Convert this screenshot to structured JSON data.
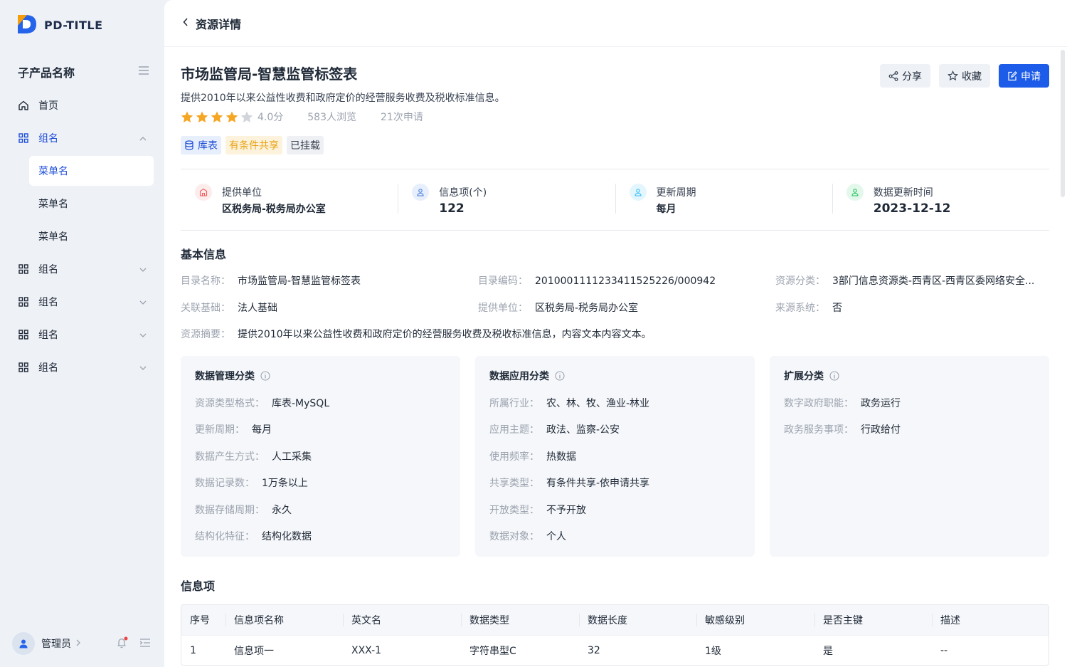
{
  "app": {
    "title": "PD-TITLE"
  },
  "sidebar": {
    "subproduct_title": "子产品名称",
    "items": [
      {
        "label": "首页",
        "icon": "home-icon"
      },
      {
        "label": "组名",
        "icon": "grid-icon",
        "expanded": true,
        "children": [
          {
            "label": "菜单名",
            "active": true
          },
          {
            "label": "菜单名"
          },
          {
            "label": "菜单名"
          }
        ]
      },
      {
        "label": "组名",
        "icon": "grid-icon"
      },
      {
        "label": "组名",
        "icon": "grid-icon"
      },
      {
        "label": "组名",
        "icon": "grid-icon"
      },
      {
        "label": "组名",
        "icon": "grid-icon"
      }
    ],
    "user": {
      "name": "管理员"
    }
  },
  "header": {
    "title": "资源详情"
  },
  "resource": {
    "title": "市场监管局-智慧监管标签表",
    "description": "提供2010年以来公益性收费和政府定价的经营服务收费及税收标准信息。",
    "rating": {
      "stars": 4,
      "max": 5,
      "score": "4.0分"
    },
    "views": "583人浏览",
    "applications": "21次申请",
    "tags": [
      "库表",
      "有条件共享",
      "已挂载"
    ]
  },
  "actions": {
    "share": "分享",
    "favorite": "收藏",
    "apply": "申请"
  },
  "stats": [
    {
      "label": "提供单位",
      "value": "区税务局-税务局办公室",
      "color": "#f25c5c",
      "icon": "building-icon"
    },
    {
      "label": "信息项(个)",
      "value": "122",
      "color": "#4a7fd8",
      "icon": "user-icon"
    },
    {
      "label": "更新周期",
      "value": "每月",
      "color": "#38bdf8",
      "icon": "user-icon"
    },
    {
      "label": "数据更新时间",
      "value": "2023-12-12",
      "color": "#22c55e",
      "icon": "user-icon"
    }
  ],
  "basic_info": {
    "title": "基本信息",
    "fields": [
      {
        "key": "目录名称：",
        "value": "市场监管局-智慧监管标签表"
      },
      {
        "key": "目录编码：",
        "value": "20100011112334115 25226/000942"
      },
      {
        "key": "资源分类：",
        "value": "3部门信息资源类-西青区-西青区委网络安全..."
      },
      {
        "key": "关联基础：",
        "value": "法人基础"
      },
      {
        "key": "提供单位：",
        "value": "区税务局-税务局办公室"
      },
      {
        "key": "来源系统：",
        "value": "否"
      },
      {
        "key": "资源摘要：",
        "value": "提供2010年以来公益性收费和政府定价的经营服务收费及税收标准信息，内容文本内容文本。"
      }
    ]
  },
  "cards": [
    {
      "title": "数据管理分类",
      "rows": [
        {
          "key": "资源类型格式：",
          "value": "库表-MySQL"
        },
        {
          "key": "更新周期：",
          "value": "每月"
        },
        {
          "key": "数据产生方式：",
          "value": "人工采集"
        },
        {
          "key": "数据记录数：",
          "value": "1万条以上"
        },
        {
          "key": "数据存储周期：",
          "value": "永久"
        },
        {
          "key": "结构化特征：",
          "value": "结构化数据"
        }
      ]
    },
    {
      "title": "数据应用分类",
      "rows": [
        {
          "key": "所属行业：",
          "value": "农、林、牧、渔业-林业"
        },
        {
          "key": "应用主题：",
          "value": "政法、监察-公安"
        },
        {
          "key": "使用频率：",
          "value": "热数据"
        },
        {
          "key": "共享类型：",
          "value": "有条件共享-依申请共享"
        },
        {
          "key": "开放类型：",
          "value": "不予开放"
        },
        {
          "key": "数据对象：",
          "value": "个人"
        }
      ]
    },
    {
      "title": "扩展分类",
      "rows": [
        {
          "key": "数字政府职能：",
          "value": "政务运行"
        },
        {
          "key": "政务服务事项：",
          "value": "行政给付"
        }
      ]
    }
  ],
  "info_items": {
    "title": "信息项",
    "columns": [
      "序号",
      "信息项名称",
      "英文名",
      "数据类型",
      "数据长度",
      "敏感级别",
      "是否主键",
      "描述"
    ],
    "rows": [
      [
        "1",
        "信息项一",
        "XXX-1",
        "字符串型C",
        "32",
        "1级",
        "是",
        "--"
      ]
    ]
  }
}
